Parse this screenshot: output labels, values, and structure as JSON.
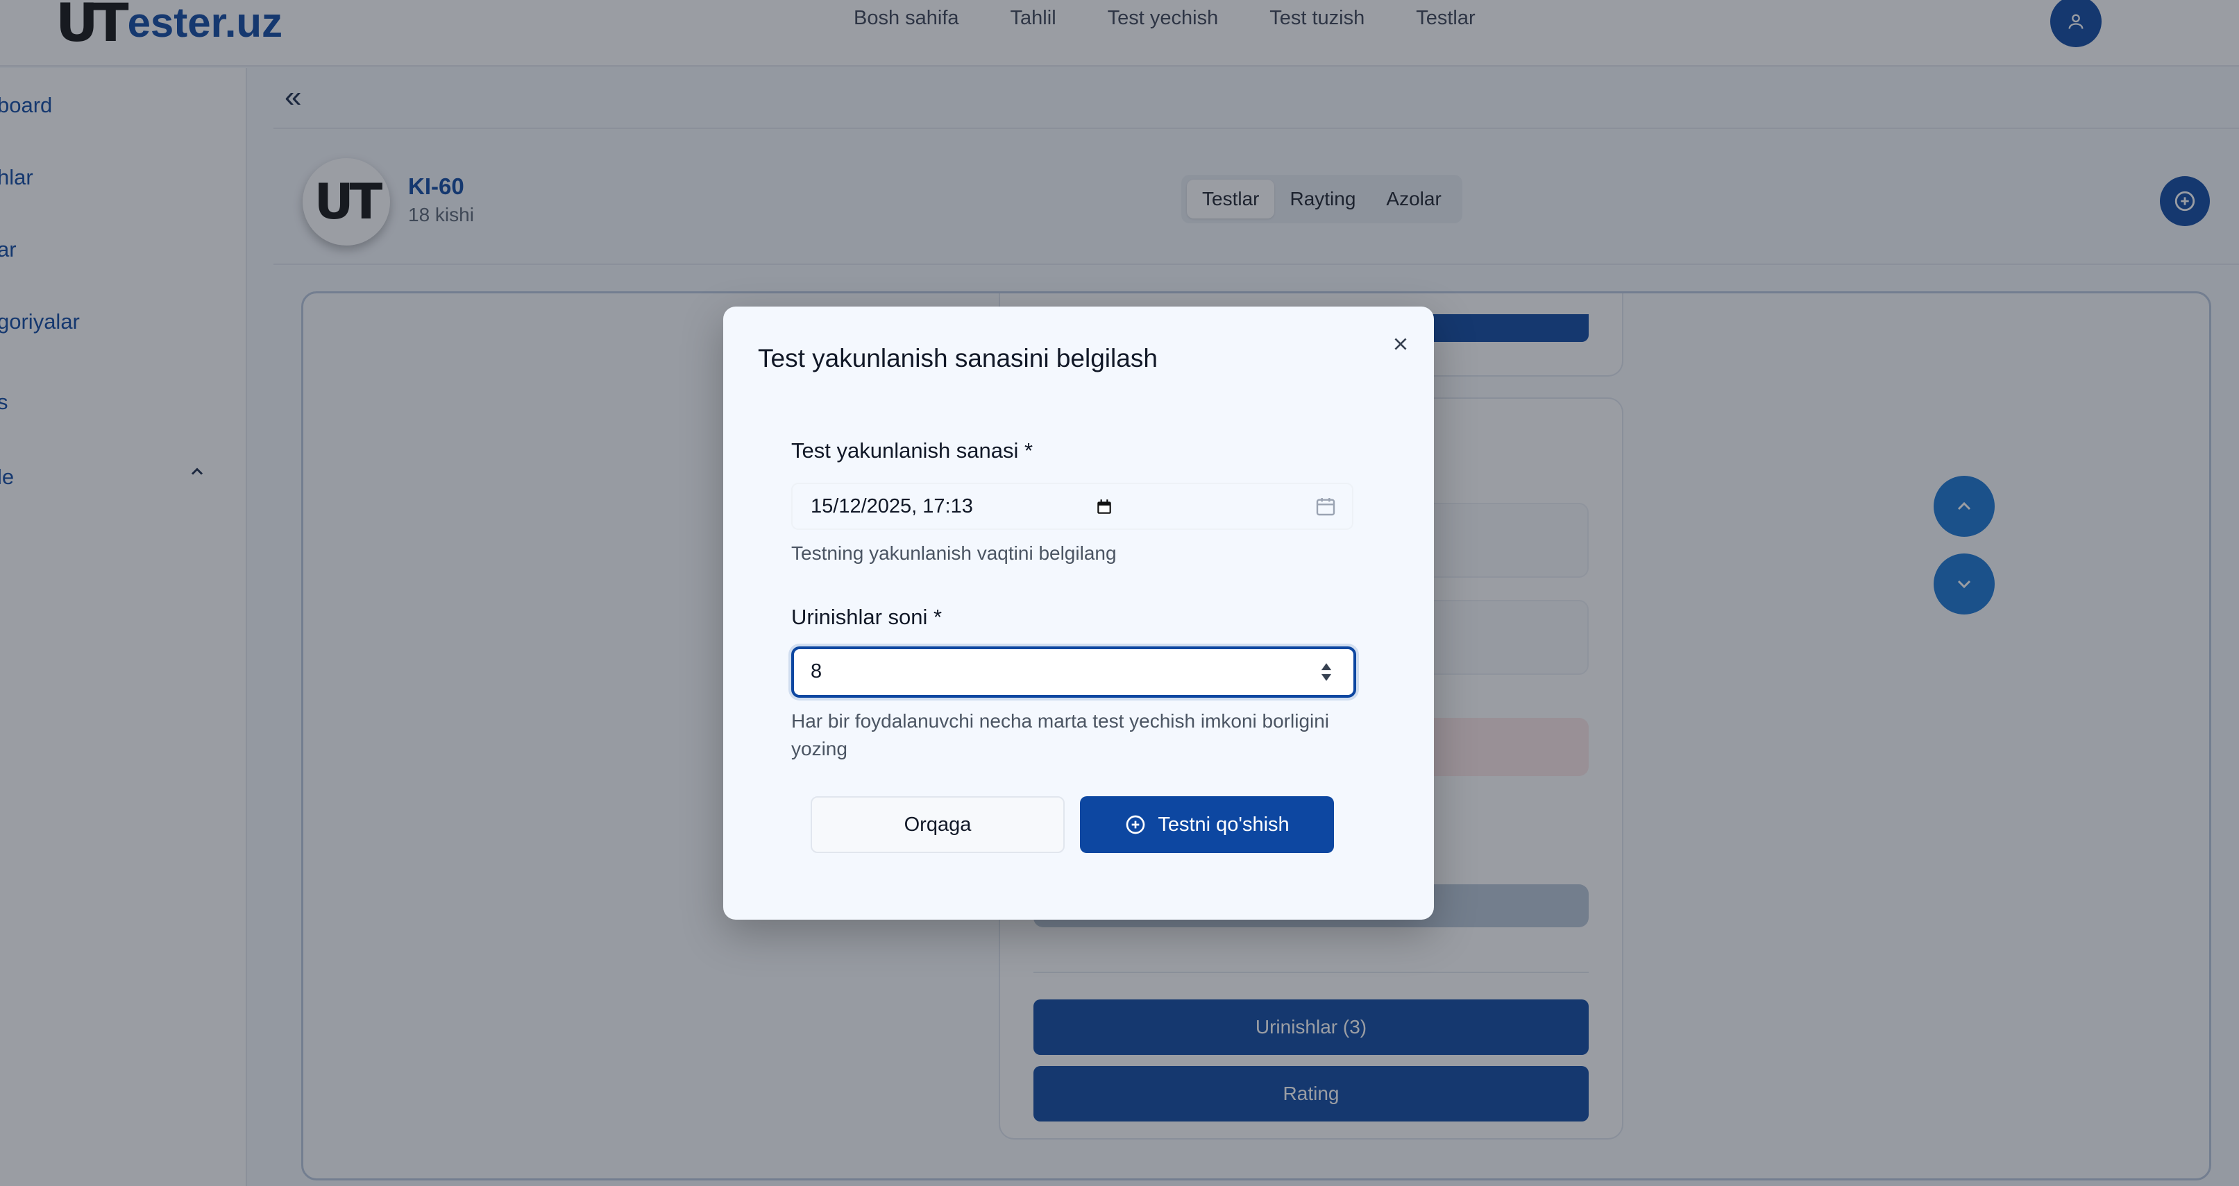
{
  "brand": {
    "mark": "UT",
    "name": "ester.uz",
    "color": "#0d47a1"
  },
  "nav": [
    "Bosh sahifa",
    "Tahlil",
    "Test yechish",
    "Test tuzish",
    "Testlar"
  ],
  "sidebar": {
    "items": [
      "board",
      "hlar",
      "ar",
      "goriyalar",
      "s",
      "le"
    ]
  },
  "group": {
    "avatar": "UT",
    "name": "KI-60",
    "count": "18 kishi",
    "tabs": [
      "Testlar",
      "Rayting",
      "Azolar"
    ],
    "active_tab": "Testlar"
  },
  "card": {
    "buttons": [
      "Urinishlar (3)",
      "Rating"
    ]
  },
  "modal": {
    "title": "Test yakunlanish sanasini belgilash",
    "date_label": "Test yakunlanish sanasi *",
    "date_value": "15/12/2025, 17:13",
    "date_help": "Testning yakunlanish vaqtini belgilang",
    "attempts_label": "Urinishlar soni *",
    "attempts_value": "8",
    "attempts_help": "Har bir foydalanuvchi necha marta test yechish imkoni borligini yozing",
    "back_label": "Orqaga",
    "submit_label": "Testni qo'shish"
  },
  "icons": {
    "user": "user-icon",
    "collapse": "double-chevron-left-icon",
    "add": "plus-circle-icon",
    "calendar": "calendar-icon",
    "close": "close-icon",
    "spinner": "spinner-arrows-icon",
    "scroll_up": "chevron-up-icon",
    "scroll_down": "chevron-down-icon"
  },
  "colors": {
    "primary": "#0d47a1",
    "scroll": "#1976d2",
    "danger_light": "#fde7e7"
  }
}
